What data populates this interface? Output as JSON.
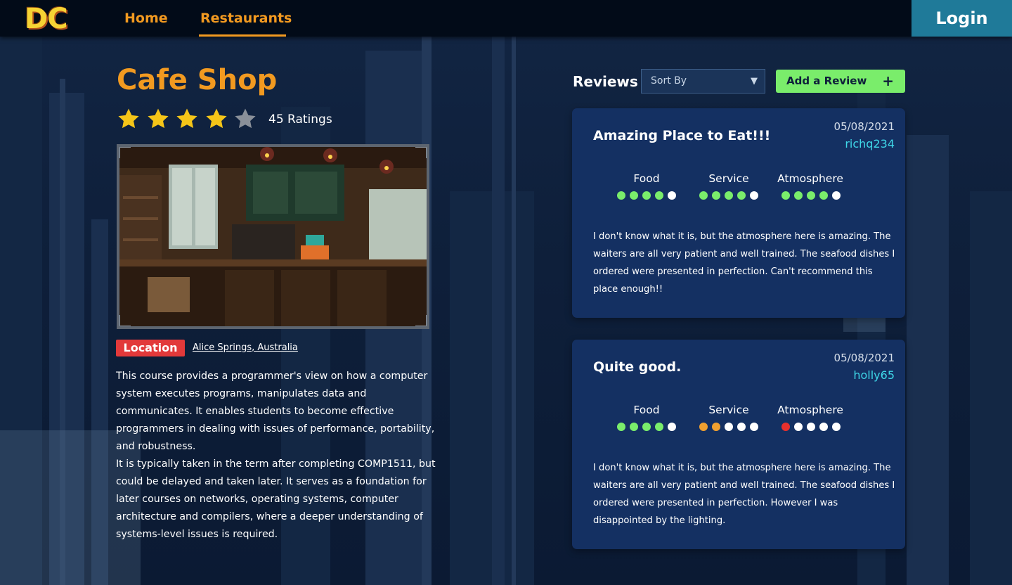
{
  "header": {
    "logo": "DC",
    "nav": [
      {
        "label": "Home"
      },
      {
        "label": "Restaurants",
        "active": true
      }
    ],
    "login_label": "Login"
  },
  "restaurant": {
    "name": "Cafe Shop",
    "rating": 4,
    "rating_max": 5,
    "ratings_count": "45 Ratings",
    "location_label": "Location",
    "location_value": "Alice Springs, Australia",
    "description": [
      "This course provides a programmer's view on how a computer system executes programs, manipulates data and communicates. It enables students to become effective programmers in dealing with issues of performance, portability, and robustness.",
      "It is typically taken in the term after completing COMP1511, but could be delayed and taken later. It serves as a foundation for later courses on networks, operating systems, computer architecture and compilers, where a deeper understanding of systems-level issues is required."
    ]
  },
  "reviews": {
    "heading": "Reviews",
    "sort_placeholder": "Sort By",
    "add_review_label": "Add a Review",
    "add_review_icon": "plus-icon",
    "items": [
      {
        "title": "Amazing Place to Eat!!!",
        "date": "05/08/2021",
        "user": "richq234",
        "categories": [
          {
            "label": "Food",
            "score": 4,
            "color": "#7aed6b"
          },
          {
            "label": "Service",
            "score": 4,
            "color": "#7aed6b"
          },
          {
            "label": "Atmosphere",
            "score": 4,
            "color": "#7aed6b"
          }
        ],
        "body": "I don't know what it is, but the atmosphere here is amazing. The waiters are all very patient and well trained. The seafood dishes I ordered were presented in perfection. Can't recommend this place enough!!"
      },
      {
        "title": "Quite good.",
        "date": "05/08/2021",
        "user": "holly65",
        "categories": [
          {
            "label": "Food",
            "score": 4,
            "color": "#7aed6b"
          },
          {
            "label": "Service",
            "score": 2,
            "color": "#f0a030"
          },
          {
            "label": "Atmosphere",
            "score": 1,
            "color": "#e8302d"
          }
        ],
        "body": "I don't know what it is, but the atmosphere here is amazing. The waiters are all very patient and well trained. The seafood dishes I ordered were presented in perfection. However I was disappointed by the lighting."
      }
    ]
  },
  "colors": {
    "accent": "#f29a20",
    "login_bg": "#1f7a99",
    "add_review_bg": "#7aed6b",
    "card_bg": "#143062",
    "location_badge": "#e2393a",
    "username": "#3fd7e8",
    "star_filled": "#f5c518",
    "star_empty": "#8a9099"
  }
}
